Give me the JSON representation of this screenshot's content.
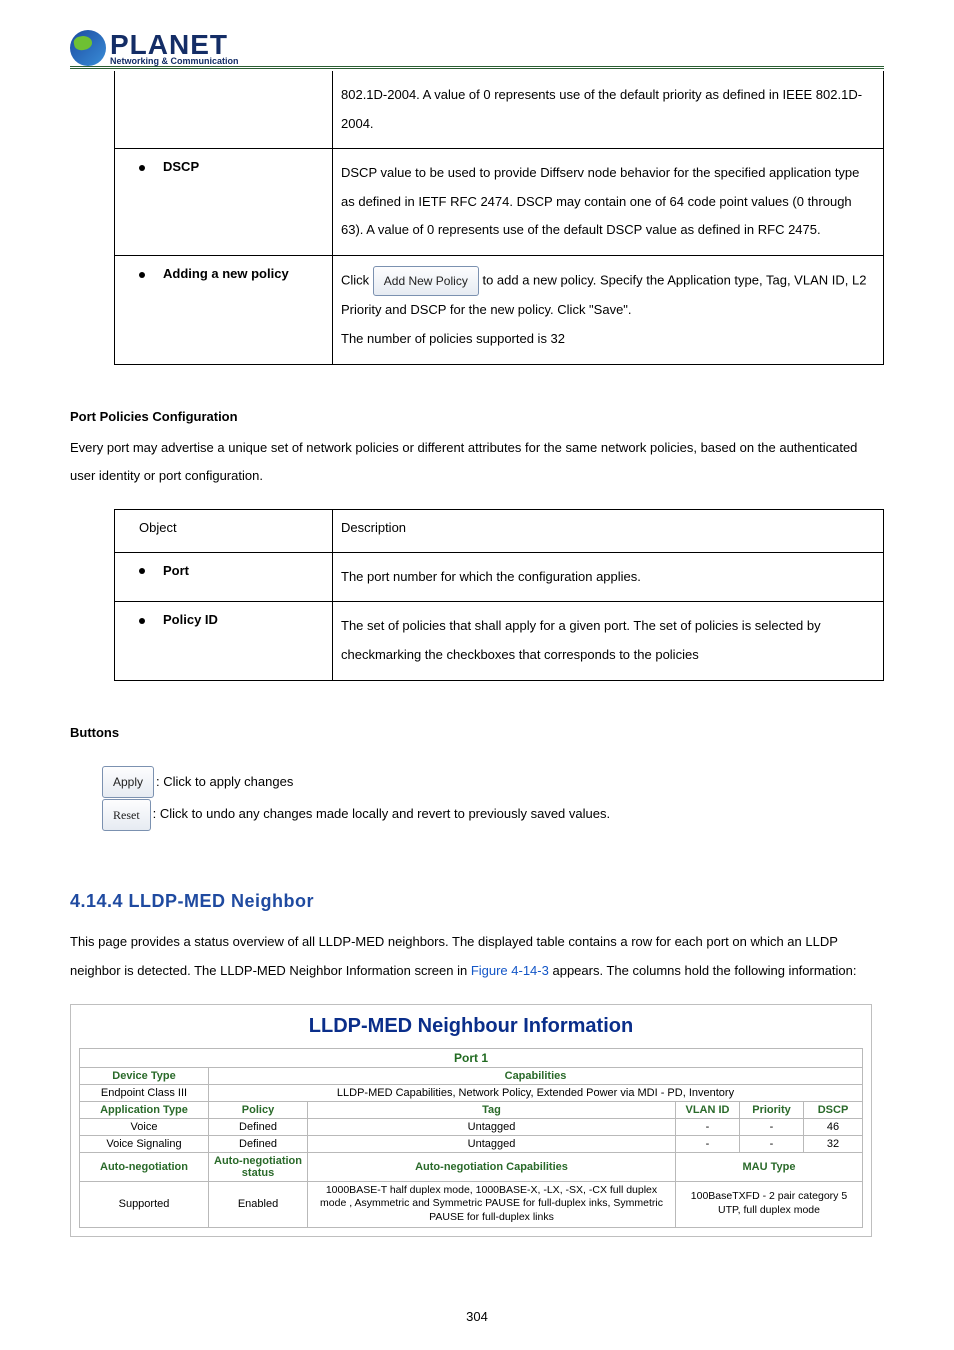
{
  "logo": {
    "brand": "PLANET",
    "tagline": "Networking & Communication"
  },
  "table1": {
    "rows": [
      {
        "bullet": false,
        "label": "",
        "desc": "802.1D-2004. A value of 0 represents use of the default priority as defined in IEEE 802.1D-2004."
      },
      {
        "bullet": true,
        "label": "DSCP",
        "desc": "DSCP value to be used to provide Diffserv node behavior for the specified application type as defined in IETF RFC 2474. DSCP may contain one of 64 code point values (0 through 63). A value of 0 represents use of the default DSCP value as defined in RFC 2475."
      },
      {
        "bullet": true,
        "label": "Adding a new policy",
        "button": "Add New Policy",
        "click": "Click ",
        "afterBtn": " to add a new policy. Specify the Application type, Tag, VLAN ID, L2 Priority and DSCP for the new policy. Click \"Save\".",
        "line2": "The number of policies supported is 32"
      }
    ]
  },
  "port_policies_heading": "Port Policies Configuration",
  "port_policies_intro": "Every port may advertise a unique set of network policies or different attributes for the same network policies, based on the authenticated user identity or port configuration.",
  "table2": {
    "headerRow": {
      "c1": "Object",
      "c2": "Description"
    },
    "rows": [
      {
        "label": "Port",
        "desc": "The port number for which the configuration applies."
      },
      {
        "label": "Policy ID",
        "desc": "The set of policies that shall apply for a given port. The set of policies is selected by checkmarking the checkboxes that corresponds to the policies"
      }
    ]
  },
  "buttons_heading": "Buttons",
  "btnApply": "Apply",
  "btnApplyDesc": ": Click to apply changes",
  "btnReset": "Reset",
  "btnResetDesc": ": Click to undo any changes made locally and revert to previously saved values.",
  "section_heading": "4.14.4 LLDP-MED Neighbor",
  "section_intro_a": "This page provides a status overview of all LLDP-MED neighbors. The displayed table contains a row for each port on which an LLDP neighbor is detected. The LLDP-MED Neighbor Information screen in ",
  "section_intro_link": "Figure 4-14-3",
  "section_intro_b": " appears. The columns hold the following information:",
  "neigh": {
    "title": "LLDP-MED Neighbour Information",
    "port": "Port 1",
    "h_devtype": "Device Type",
    "h_caps": "Capabilities",
    "devtype": "Endpoint Class III",
    "caps": "LLDP-MED Capabilities, Network Policy, Extended Power via MDI - PD, Inventory",
    "h_apptype": "Application Type",
    "h_policy": "Policy",
    "h_tag": "Tag",
    "h_vlan": "VLAN ID",
    "h_prio": "Priority",
    "h_dscp": "DSCP",
    "rows": [
      {
        "app": "Voice",
        "policy": "Defined",
        "tag": "Untagged",
        "vlan": "-",
        "prio": "-",
        "dscp": "46"
      },
      {
        "app": "Voice Signaling",
        "policy": "Defined",
        "tag": "Untagged",
        "vlan": "-",
        "prio": "-",
        "dscp": "32"
      }
    ],
    "h_autoneg": "Auto-negotiation",
    "h_autoneg_status": "Auto-negotiation status",
    "h_autoneg_caps": "Auto-negotiation Capabilities",
    "h_mau": "MAU Type",
    "autoneg": "Supported",
    "autoneg_status": "Enabled",
    "autoneg_caps": "1000BASE-T half duplex mode, 1000BASE-X, -LX, -SX, -CX full duplex mode , Asymmetric and Symmetric PAUSE for full-duplex inks, Symmetric PAUSE for full-duplex links",
    "mau": "100BaseTXFD - 2 pair category 5 UTP, full duplex mode"
  },
  "pagenum": "304"
}
